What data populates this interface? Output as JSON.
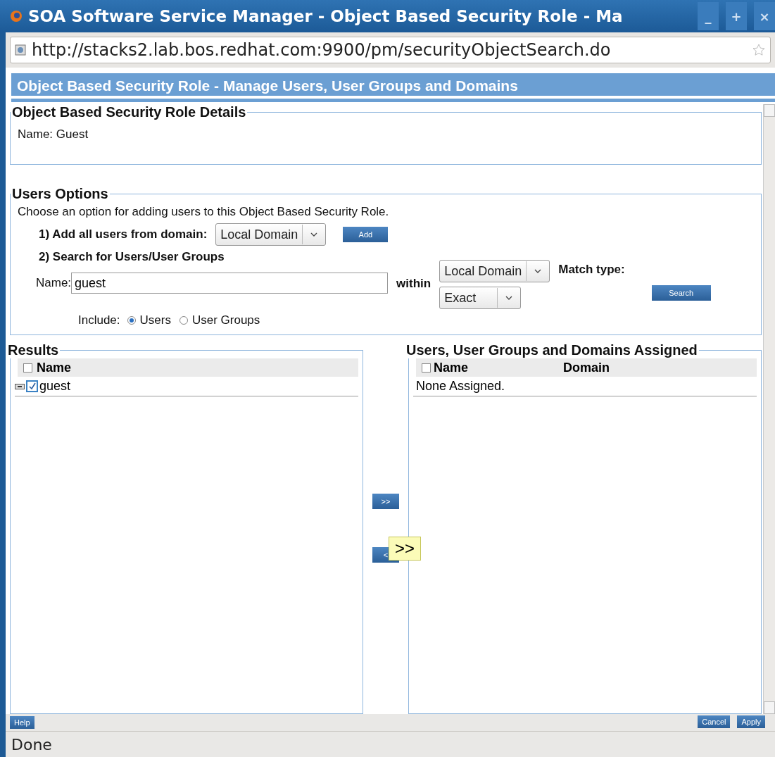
{
  "window": {
    "title": "SOA Software Service Manager - Object Based Security Role - Ma",
    "controls": [
      "_",
      "+",
      "×"
    ]
  },
  "address_bar": {
    "url": "http://stacks2.lab.bos.redhat.com:9900/pm/securityObjectSearch.do"
  },
  "page_header": "Object Based Security Role - Manage Users, User Groups and Domains",
  "details": {
    "legend": "Object Based Security Role Details",
    "name": "Name: Guest"
  },
  "users_options": {
    "legend": "Users Options",
    "intro": "Choose an option for adding users to this Object Based Security Role.",
    "option1_label": "1) Add all users from domain:",
    "option1_domain": "Local Domain",
    "add_button": "Add",
    "option2_label": "2) Search for Users/User Groups",
    "name_label": "Name:",
    "name_value": "guest",
    "within_label": "within",
    "within_domain": "Local Domain",
    "match_type_label": "Match type:",
    "match_type": "Exact",
    "search_button": "Search",
    "include_label": "Include:",
    "include_options": [
      {
        "label": "Users",
        "selected": true
      },
      {
        "label": "User Groups",
        "selected": false
      }
    ]
  },
  "results": {
    "legend": "Results",
    "column": "Name",
    "select_all_checked": false,
    "rows": [
      {
        "name": "guest",
        "checked": true
      }
    ]
  },
  "transfer_buttons": [
    ">>",
    "<"
  ],
  "tooltip": ">>",
  "assigned": {
    "legend": "Users, User Groups and Domains Assigned",
    "columns": [
      "Name",
      "Domain"
    ],
    "select_all_checked": false,
    "empty_text": "None Assigned."
  },
  "footer_buttons": {
    "left": [
      "Help"
    ],
    "right": [
      "Cancel",
      "Apply"
    ]
  },
  "status_bar": "Done"
}
